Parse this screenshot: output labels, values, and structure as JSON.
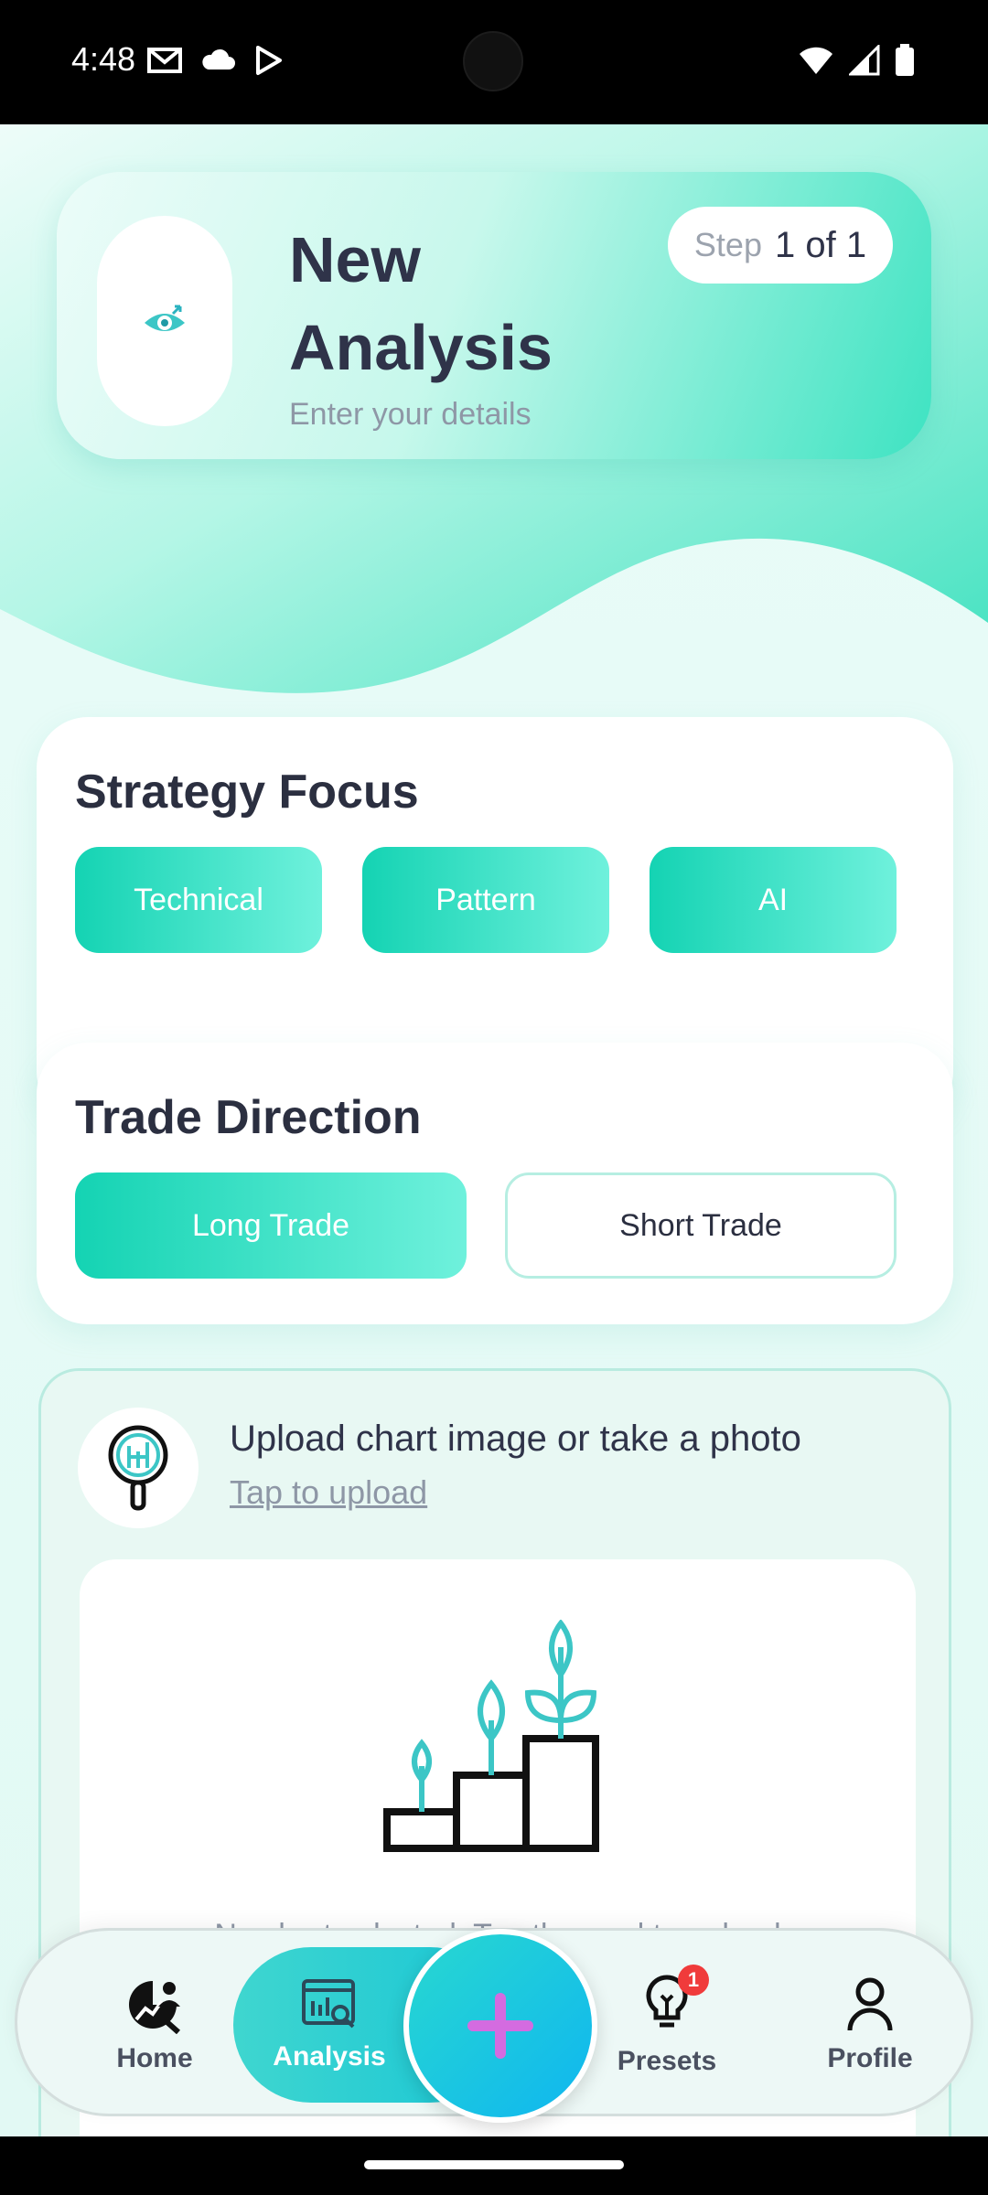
{
  "status_bar": {
    "time": "4:48",
    "left_icons": [
      "gmail-icon",
      "cloud-icon",
      "play-store-icon"
    ],
    "right_icons": [
      "wifi-icon",
      "signal-icon",
      "battery-icon"
    ]
  },
  "header": {
    "title": "New Analysis",
    "subtitle": "Enter your details",
    "step_label": "Step",
    "step_value": "1 of 1",
    "icon": "eye-icon"
  },
  "strategy": {
    "title": "Strategy Focus",
    "options": [
      "Technical",
      "Pattern",
      "AI"
    ]
  },
  "direction": {
    "title": "Trade Direction",
    "long_label": "Long Trade",
    "short_label": "Short Trade"
  },
  "upload": {
    "title": "Upload chart image or take a photo",
    "link": "Tap to upload",
    "empty_text": "No chart selected. Tap the card to upload",
    "icon": "magnifier-chart-icon"
  },
  "nav": {
    "items": [
      {
        "label": "Home",
        "icon": "home-analytics-icon"
      },
      {
        "label": "Analysis",
        "icon": "analysis-icon"
      },
      {
        "label": "Presets",
        "icon": "lightbulb-icon",
        "badge": "1"
      },
      {
        "label": "Profile",
        "icon": "person-icon"
      }
    ],
    "fab_icon": "plus-icon"
  },
  "colors": {
    "accent": "#14d3b3",
    "accent_light": "#6ff1dc",
    "text_dark": "#2b2f40",
    "muted": "#8e97a6",
    "badge": "#f03b3b"
  }
}
